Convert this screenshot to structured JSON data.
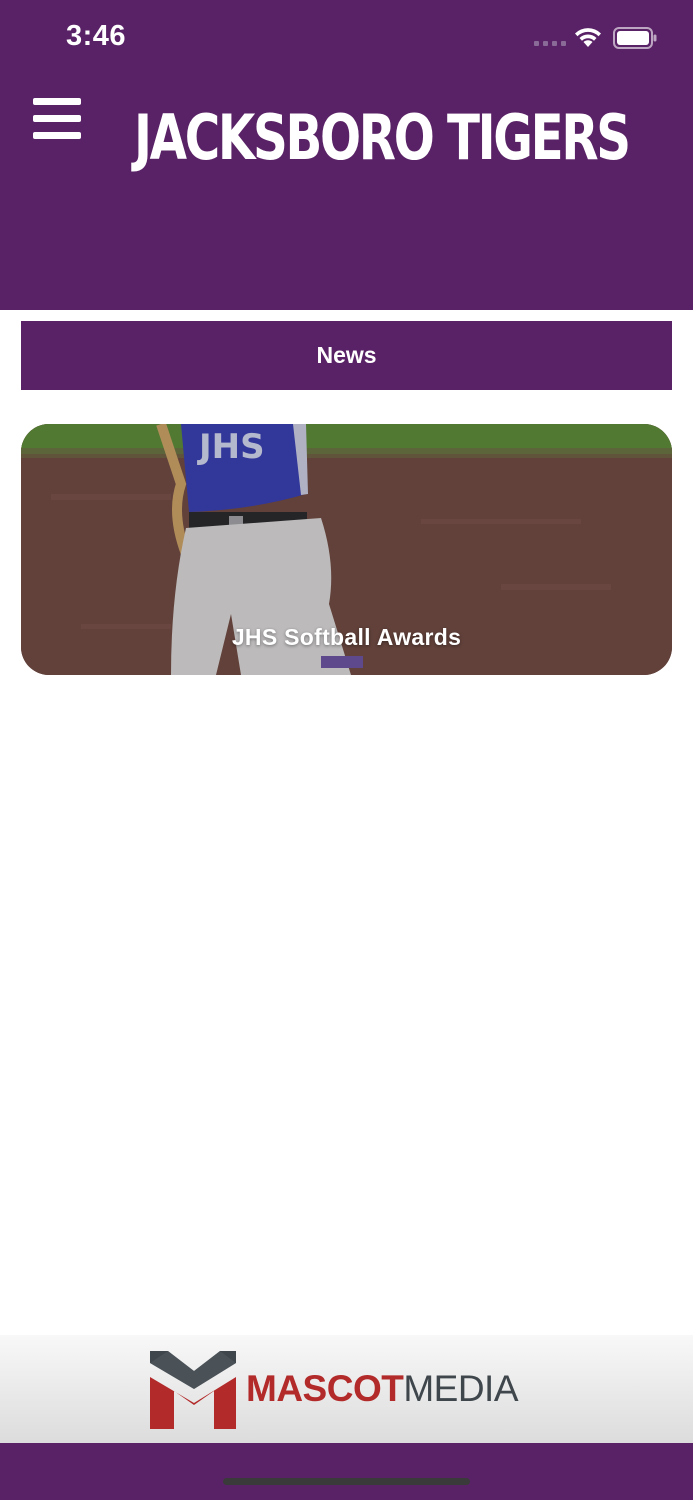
{
  "status_bar": {
    "time": "3:46"
  },
  "header": {
    "title": "JACKSBORO TIGERS"
  },
  "section": {
    "label": "News"
  },
  "news_items": [
    {
      "title": "JHS Softball Awards",
      "jersey_text": "JHS"
    }
  ],
  "footer": {
    "logo_part1": "MASCOT",
    "logo_part2": "MEDIA"
  },
  "colors": {
    "brand_purple": "#5a2266",
    "logo_red": "#b32a2a",
    "logo_gray": "#3f474d"
  },
  "icons": [
    "menu-icon",
    "wifi-icon",
    "battery-icon",
    "signal-icon"
  ]
}
